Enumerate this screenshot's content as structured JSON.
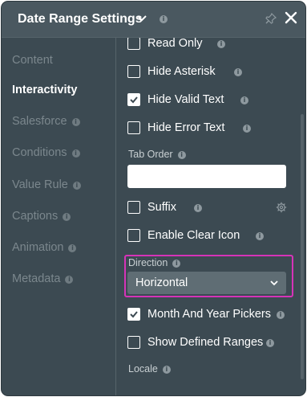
{
  "header": {
    "title": "Date Range Settings",
    "close_glyph": "✕"
  },
  "sidebar": {
    "items": [
      {
        "label": "Content"
      },
      {
        "label": "Interactivity"
      },
      {
        "label": "Salesforce"
      },
      {
        "label": "Conditions"
      },
      {
        "label": "Value Rule"
      },
      {
        "label": "Captions"
      },
      {
        "label": "Animation"
      },
      {
        "label": "Metadata"
      }
    ],
    "active": "Interactivity"
  },
  "content": {
    "read_only": {
      "label": "Read Only",
      "checked": false
    },
    "hide_asterisk": {
      "label": "Hide Asterisk",
      "checked": false
    },
    "hide_valid_text": {
      "label": "Hide Valid Text",
      "checked": true
    },
    "hide_error_text": {
      "label": "Hide Error Text",
      "checked": false
    },
    "tab_order": {
      "label": "Tab Order",
      "value": ""
    },
    "suffix": {
      "label": "Suffix",
      "checked": false
    },
    "enable_clear_icon": {
      "label": "Enable Clear Icon",
      "checked": false
    },
    "direction": {
      "label": "Direction",
      "value": "Horizontal"
    },
    "month_year_pickers": {
      "label": "Month And Year Pickers",
      "checked": true
    },
    "show_defined_ranges": {
      "label": "Show Defined Ranges",
      "checked": false
    },
    "locale": {
      "label": "Locale"
    }
  },
  "colors": {
    "panel_bg": "#3c4a52",
    "header_bg": "#4a5860",
    "highlight_border": "#d633b8",
    "select_bg": "#5f6d74"
  }
}
